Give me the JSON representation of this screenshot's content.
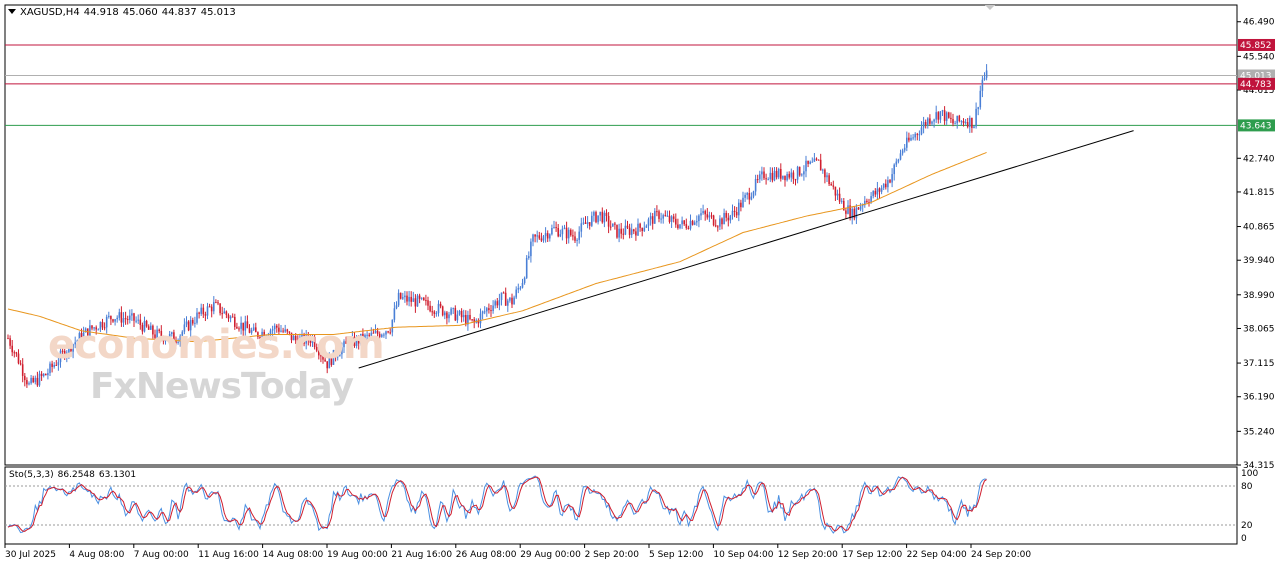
{
  "header": {
    "symbol": "XAGUSD,H4",
    "open": "44.918",
    "high": "45.060",
    "low": "44.837",
    "close": "45.013"
  },
  "watermark": {
    "line1": "economies.com",
    "line2": "FxNewsToday"
  },
  "chart_data": {
    "type": "candlestick",
    "symbol": "XAGUSD",
    "timeframe": "H4",
    "y_ticks": [
      "46.490",
      "45.540",
      "44.615",
      "42.740",
      "41.815",
      "40.865",
      "39.940",
      "38.990",
      "38.065",
      "37.115",
      "36.190",
      "35.240",
      "34.315"
    ],
    "ylim": [
      34.315,
      46.95
    ],
    "x_ticks": [
      "30 Jul 2025",
      "4 Aug 08:00",
      "7 Aug 00:00",
      "11 Aug 16:00",
      "14 Aug 08:00",
      "19 Aug 00:00",
      "21 Aug 16:00",
      "26 Aug 08:00",
      "29 Aug 00:00",
      "2 Sep 20:00",
      "5 Sep 12:00",
      "10 Sep 04:00",
      "12 Sep 20:00",
      "17 Sep 12:00",
      "22 Sep 04:00",
      "24 Sep 20:00"
    ],
    "price_anchors": [
      [
        0,
        37.8
      ],
      [
        5,
        37.2
      ],
      [
        10,
        36.5
      ],
      [
        18,
        36.8
      ],
      [
        28,
        37.5
      ],
      [
        38,
        38.0
      ],
      [
        50,
        38.4
      ],
      [
        60,
        38.3
      ],
      [
        70,
        37.9
      ],
      [
        80,
        37.8
      ],
      [
        90,
        38.4
      ],
      [
        98,
        38.7
      ],
      [
        110,
        38.2
      ],
      [
        118,
        37.9
      ],
      [
        128,
        38.1
      ],
      [
        138,
        37.7
      ],
      [
        145,
        37.8
      ],
      [
        152,
        37.1
      ],
      [
        158,
        37.5
      ],
      [
        165,
        37.7
      ],
      [
        175,
        37.9
      ],
      [
        182,
        38.1
      ],
      [
        186,
        38.9
      ],
      [
        195,
        38.8
      ],
      [
        205,
        38.6
      ],
      [
        215,
        38.4
      ],
      [
        222,
        38.2
      ],
      [
        228,
        38.6
      ],
      [
        235,
        38.9
      ],
      [
        240,
        38.8
      ],
      [
        245,
        39.4
      ],
      [
        250,
        40.5
      ],
      [
        260,
        40.8
      ],
      [
        270,
        40.6
      ],
      [
        276,
        41.0
      ],
      [
        282,
        41.2
      ],
      [
        290,
        40.7
      ],
      [
        300,
        40.8
      ],
      [
        310,
        41.2
      ],
      [
        316,
        41.0
      ],
      [
        322,
        40.9
      ],
      [
        330,
        41.2
      ],
      [
        338,
        41.0
      ],
      [
        345,
        41.2
      ],
      [
        352,
        41.7
      ],
      [
        360,
        42.3
      ],
      [
        368,
        42.3
      ],
      [
        375,
        42.3
      ],
      [
        380,
        42.5
      ],
      [
        386,
        42.6
      ],
      [
        392,
        42.0
      ],
      [
        397,
        41.5
      ],
      [
        402,
        41.2
      ],
      [
        408,
        41.6
      ],
      [
        414,
        41.8
      ],
      [
        420,
        42.2
      ],
      [
        426,
        43.0
      ],
      [
        432,
        43.4
      ],
      [
        438,
        43.8
      ],
      [
        444,
        44.0
      ],
      [
        450,
        43.7
      ],
      [
        456,
        43.8
      ],
      [
        460,
        43.7
      ],
      [
        464,
        44.9
      ],
      [
        466,
        45.0
      ]
    ],
    "sma_anchors": [
      [
        0,
        38.6
      ],
      [
        15,
        38.4
      ],
      [
        35,
        38.0
      ],
      [
        60,
        37.8
      ],
      [
        90,
        37.7
      ],
      [
        125,
        37.9
      ],
      [
        155,
        37.9
      ],
      [
        185,
        38.1
      ],
      [
        215,
        38.15
      ],
      [
        245,
        38.55
      ],
      [
        280,
        39.3
      ],
      [
        320,
        39.9
      ],
      [
        350,
        40.7
      ],
      [
        380,
        41.15
      ],
      [
        410,
        41.5
      ],
      [
        440,
        42.3
      ],
      [
        466,
        42.9
      ]
    ],
    "trendline": {
      "from": [
        167,
        36.98
      ],
      "to": [
        536,
        43.5
      ]
    },
    "horizontal_levels": [
      {
        "value": 45.852,
        "label": "45.852",
        "color": "#c0143c"
      },
      {
        "value": 45.013,
        "label": "45.013",
        "color": "#b0b0b0"
      },
      {
        "value": 44.783,
        "label": "44.783",
        "color": "#c0143c"
      },
      {
        "value": 43.643,
        "label": "43.643",
        "color": "#2e9d4e"
      }
    ],
    "stochastic": {
      "label": "Sto(5,3,3)",
      "main": "86.2548",
      "signal": "63.1301",
      "levels": [
        "100",
        "80",
        "20",
        "0"
      ]
    },
    "colors": {
      "up": "#4a7fd6",
      "down": "#d01e2e",
      "sma": "#e8961e",
      "trend": "#000000",
      "stoch_main": "#4a90e2",
      "stoch_signal": "#d01e2e"
    }
  }
}
